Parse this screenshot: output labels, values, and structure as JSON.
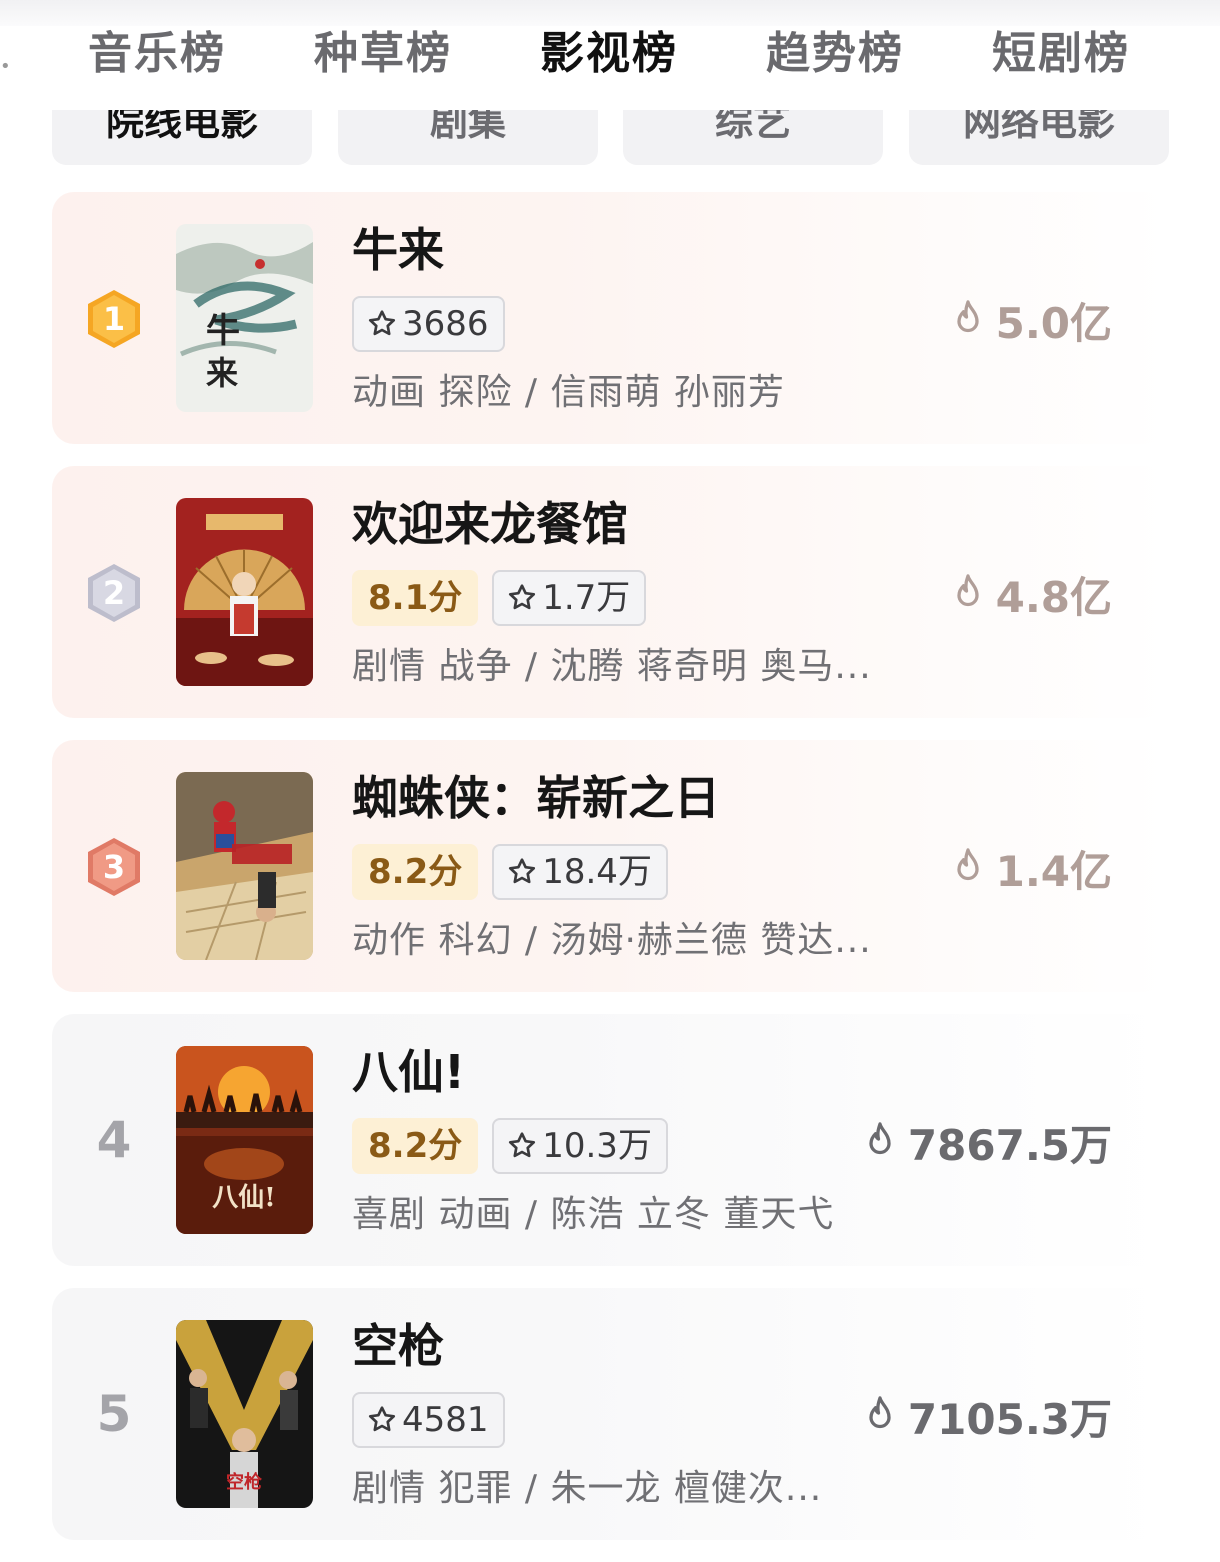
{
  "main_tabs": [
    {
      "label": "音乐榜",
      "active": false
    },
    {
      "label": "种草榜",
      "active": false
    },
    {
      "label": "影视榜",
      "active": true
    },
    {
      "label": "趋势榜",
      "active": false
    },
    {
      "label": "短剧榜",
      "active": false
    }
  ],
  "sub_tabs": [
    {
      "label": "院线电影",
      "active": true
    },
    {
      "label": "剧集",
      "active": false
    },
    {
      "label": "综艺",
      "active": false
    },
    {
      "label": "网络电影",
      "active": false
    }
  ],
  "ranking": [
    {
      "rank": "1",
      "title": "牛来",
      "score": "",
      "want": "3686",
      "meta": "动画 探险 / 信雨萌 孙丽芳",
      "heat": "5.0亿"
    },
    {
      "rank": "2",
      "title": "欢迎来龙餐馆",
      "score": "8.1分",
      "want": "1.7万",
      "meta": "剧情 战争 / 沈腾 蒋奇明 奥马...",
      "heat": "4.8亿"
    },
    {
      "rank": "3",
      "title": "蜘蛛侠：崭新之日",
      "score": "8.2分",
      "want": "18.4万",
      "meta": "动作 科幻 / 汤姆·赫兰德 赞达...",
      "heat": "1.4亿"
    },
    {
      "rank": "4",
      "title": "八仙!",
      "score": "8.2分",
      "want": "10.3万",
      "meta": "喜剧 动画 / 陈浩 立冬 董天弋",
      "heat": "7867.5万"
    },
    {
      "rank": "5",
      "title": "空枪",
      "score": "",
      "want": "4581",
      "meta": "剧情 犯罪 / 朱一龙 檀健次...",
      "heat": "7105.3万"
    }
  ],
  "colors": {
    "medal_gold": "#f5a623",
    "medal_silver": "#c9c9d6",
    "medal_bronze": "#e58b78",
    "score_bg": "#fdf0d5",
    "score_text": "#8a5a16"
  },
  "icons": {
    "want": "star-outline-icon",
    "heat": "flame-outline-icon"
  }
}
